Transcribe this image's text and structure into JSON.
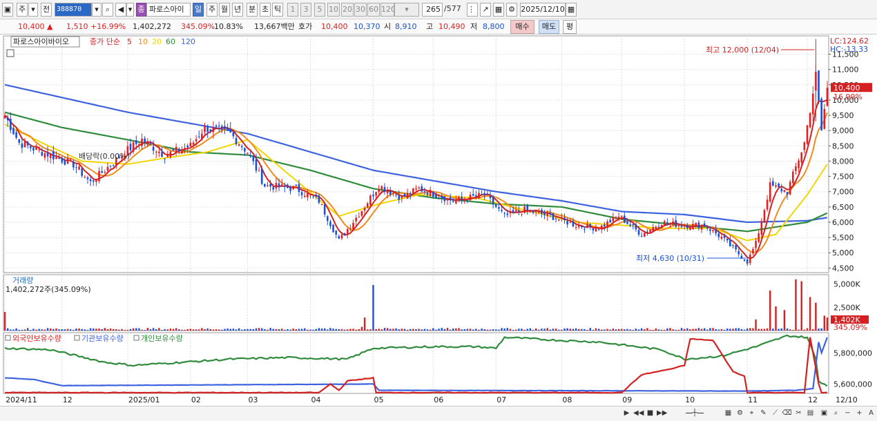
{
  "toolbar": {
    "market": "주",
    "prev": "전",
    "code": "388870",
    "badge": "종",
    "stock_name": "파로스아이",
    "periods": [
      "일",
      "주",
      "월",
      "년",
      "분",
      "초",
      "틱"
    ],
    "active_period": "일",
    "intervals": [
      "1",
      "3",
      "5",
      "10",
      "20",
      "30",
      "60",
      "120"
    ],
    "count_value": "265",
    "count_total": "/577",
    "date": "2025/12/10"
  },
  "price": {
    "current": "10,400",
    "change": "1,510",
    "change_pct": "+16.99%",
    "volume": "1,402,272",
    "volume_pct": "345.09%",
    "turnover": "10.83%",
    "amount": "13,667백만",
    "quote_label": "호가",
    "ask": "10,400",
    "bid": "10,370",
    "open_label": "시",
    "open": "8,910",
    "high_label": "고",
    "high": "10,490",
    "low_label": "저",
    "low": "8,800",
    "buy_label": "매수",
    "sell_label": "매도",
    "eval_label": "평"
  },
  "chart_data": [
    {
      "type": "candlestick",
      "title": "파로스아이바이오",
      "legend_prefix": "종가 단순",
      "ma_periods": [
        5,
        10,
        20,
        60,
        120
      ],
      "ma_colors": [
        "#d42020",
        "#f08a1c",
        "#f2d600",
        "#2e8b3a",
        "#3c62e0"
      ],
      "y_ticks": [
        4500,
        5000,
        5500,
        6000,
        6500,
        7000,
        7500,
        8000,
        8500,
        9000,
        9500,
        10000,
        10500,
        11000,
        11500
      ],
      "y_tick_labels": [
        "4,500",
        "5,000",
        "5,500",
        "6,000",
        "6,500",
        "7,000",
        "7,500",
        "8,000",
        "8,500",
        "9,000",
        "9,500",
        "10,000",
        "10,500",
        "11,000",
        "11,500"
      ],
      "ylim": [
        4350,
        12100
      ],
      "x_labels": [
        "2024/11",
        "12",
        "2025/01",
        "02",
        "03",
        "04",
        "05",
        "06",
        "07",
        "08",
        "09",
        "10",
        "11",
        "12",
        "12/10"
      ],
      "x_label_dates": [
        "2024-11-01",
        "2024-12-01",
        "2025-01-01",
        "2025-02-01",
        "2025-03-01",
        "2025-04-01",
        "2025-05-01",
        "2025-06-01",
        "2025-07-01",
        "2025-08-01",
        "2025-09-01",
        "2025-10-01",
        "2025-11-01",
        "2025-12-01",
        "2025-12-10"
      ],
      "close_keypoints": [
        [
          "2024-11-01",
          9500
        ],
        [
          "2024-11-10",
          8600
        ],
        [
          "2024-11-20",
          8300
        ],
        [
          "2024-12-05",
          7900
        ],
        [
          "2024-12-15",
          7300
        ],
        [
          "2024-12-31",
          8300
        ],
        [
          "2025-01-08",
          8700
        ],
        [
          "2025-01-20",
          8200
        ],
        [
          "2025-01-31",
          8500
        ],
        [
          "2025-02-08",
          9100
        ],
        [
          "2025-02-20",
          8900
        ],
        [
          "2025-03-01",
          8300
        ],
        [
          "2025-03-10",
          7200
        ],
        [
          "2025-03-25",
          7100
        ],
        [
          "2025-04-05",
          6700
        ],
        [
          "2025-04-15",
          5400
        ],
        [
          "2025-04-25",
          6400
        ],
        [
          "2025-05-05",
          7200
        ],
        [
          "2025-05-15",
          6800
        ],
        [
          "2025-05-25",
          7100
        ],
        [
          "2025-06-10",
          6700
        ],
        [
          "2025-06-25",
          6900
        ],
        [
          "2025-07-05",
          6200
        ],
        [
          "2025-07-15",
          6400
        ],
        [
          "2025-07-28",
          6200
        ],
        [
          "2025-08-10",
          5900
        ],
        [
          "2025-08-20",
          5800
        ],
        [
          "2025-08-31",
          6200
        ],
        [
          "2025-09-10",
          5600
        ],
        [
          "2025-09-20",
          6000
        ],
        [
          "2025-09-30",
          5900
        ],
        [
          "2025-10-10",
          5900
        ],
        [
          "2025-10-20",
          5500
        ],
        [
          "2025-10-31",
          4700
        ],
        [
          "2025-11-05",
          5300
        ],
        [
          "2025-11-12",
          7200
        ],
        [
          "2025-11-20",
          7000
        ],
        [
          "2025-11-28",
          8600
        ],
        [
          "2025-12-04",
          10800
        ],
        [
          "2025-12-08",
          9000
        ],
        [
          "2025-12-10",
          10400
        ]
      ],
      "ma_keypoints": {
        "120": [
          [
            "2024-11-01",
            10500
          ],
          [
            "2025-01-01",
            9600
          ],
          [
            "2025-03-01",
            8900
          ],
          [
            "2025-05-01",
            7700
          ],
          [
            "2025-07-01",
            7000
          ],
          [
            "2025-08-01",
            6700
          ],
          [
            "2025-09-01",
            6350
          ],
          [
            "2025-10-01",
            6250
          ],
          [
            "2025-11-01",
            6000
          ],
          [
            "2025-12-01",
            6050
          ],
          [
            "2025-12-10",
            6150
          ]
        ],
        "60": [
          [
            "2024-11-01",
            9600
          ],
          [
            "2024-12-01",
            9100
          ],
          [
            "2025-01-01",
            8700
          ],
          [
            "2025-02-01",
            8300
          ],
          [
            "2025-03-01",
            8200
          ],
          [
            "2025-04-01",
            7700
          ],
          [
            "2025-05-01",
            7100
          ],
          [
            "2025-06-01",
            6800
          ],
          [
            "2025-07-01",
            6600
          ],
          [
            "2025-08-01",
            6500
          ],
          [
            "2025-09-01",
            6100
          ],
          [
            "2025-10-01",
            5900
          ],
          [
            "2025-11-01",
            5700
          ],
          [
            "2025-12-01",
            6000
          ],
          [
            "2025-12-10",
            6300
          ]
        ],
        "20": [
          [
            "2024-11-01",
            9200
          ],
          [
            "2024-11-20",
            8600
          ],
          [
            "2024-12-10",
            8000
          ],
          [
            "2025-01-01",
            7900
          ],
          [
            "2025-01-20",
            8100
          ],
          [
            "2025-02-10",
            8300
          ],
          [
            "2025-03-01",
            8700
          ],
          [
            "2025-03-20",
            7600
          ],
          [
            "2025-04-15",
            6200
          ],
          [
            "2025-05-05",
            6600
          ],
          [
            "2025-05-25",
            6900
          ],
          [
            "2025-06-20",
            6800
          ],
          [
            "2025-07-15",
            6400
          ],
          [
            "2025-08-10",
            6000
          ],
          [
            "2025-09-01",
            5900
          ],
          [
            "2025-09-20",
            5800
          ],
          [
            "2025-10-15",
            5800
          ],
          [
            "2025-11-01",
            5400
          ],
          [
            "2025-11-15",
            5600
          ],
          [
            "2025-12-01",
            6900
          ],
          [
            "2025-12-10",
            7900
          ]
        ]
      },
      "annotations": [
        {
          "text": "최고 12,000 (12/04)",
          "date": "2025-12-04",
          "value": 12000
        },
        {
          "text": "최저 4,630 (10/31)",
          "date": "2025-10-31",
          "value": 4630
        },
        {
          "text": "배당락(0.00%)",
          "date": "2024-12-27",
          "value": 8000
        }
      ],
      "last_price_label": "10,400",
      "last_pct_label": "16.99%",
      "lc_label": "LC:124.62",
      "hc_label": "HC:-13.33"
    },
    {
      "type": "bar",
      "title": "거래량",
      "summary": "1,402,272주(345.09%)",
      "y_ticks": [
        2500000,
        5000000
      ],
      "y_tick_labels": [
        "2,500K",
        "5,000K"
      ],
      "ylim": [
        0,
        6000000
      ],
      "last_volume_label": "1,402K",
      "last_pct_label": "345.09%",
      "volume_spikes": [
        [
          "2024-11-01",
          2000000
        ],
        [
          "2025-04-25",
          400000
        ],
        [
          "2025-05-01",
          4900000
        ],
        [
          "2025-04-28",
          1400000
        ],
        [
          "2025-11-05",
          1200000
        ],
        [
          "2025-11-12",
          4300000
        ],
        [
          "2025-11-14",
          2600000
        ],
        [
          "2025-11-19",
          2200000
        ],
        [
          "2025-11-25",
          5500000
        ],
        [
          "2025-11-27",
          5300000
        ],
        [
          "2025-12-02",
          3600000
        ],
        [
          "2025-12-04",
          3000000
        ],
        [
          "2025-12-09",
          1600000
        ],
        [
          "2025-12-10",
          1400000
        ]
      ],
      "base_volume": 180000
    },
    {
      "type": "line",
      "series_names": [
        "외국인보유수량",
        "기관보유수량",
        "개인보유수량"
      ],
      "series_colors": [
        "#d42020",
        "#3c62e0",
        "#2e8b3a"
      ],
      "y_ticks": [
        5600000,
        5800000
      ],
      "y_tick_labels": [
        "5,600,000",
        "5,800,000"
      ],
      "ylim": [
        5540000,
        5930000
      ],
      "individual_keypoints": [
        [
          "2024-11-01",
          5830000
        ],
        [
          "2024-11-25",
          5820000
        ],
        [
          "2024-12-20",
          5740000
        ],
        [
          "2025-01-05",
          5720000
        ],
        [
          "2025-02-20",
          5760000
        ],
        [
          "2025-03-20",
          5770000
        ],
        [
          "2025-04-20",
          5760000
        ],
        [
          "2025-05-01",
          5830000
        ],
        [
          "2025-06-01",
          5840000
        ],
        [
          "2025-06-20",
          5840000
        ],
        [
          "2025-07-01",
          5830000
        ],
        [
          "2025-07-05",
          5900000
        ],
        [
          "2025-08-01",
          5880000
        ],
        [
          "2025-08-20",
          5870000
        ],
        [
          "2025-09-20",
          5820000
        ],
        [
          "2025-10-01",
          5760000
        ],
        [
          "2025-10-20",
          5780000
        ],
        [
          "2025-11-05",
          5840000
        ],
        [
          "2025-11-20",
          5910000
        ],
        [
          "2025-12-01",
          5900000
        ],
        [
          "2025-12-04",
          5760000
        ],
        [
          "2025-12-06",
          5620000
        ],
        [
          "2025-12-10",
          5590000
        ]
      ],
      "institution_keypoints": [
        [
          "2024-11-01",
          5640000
        ],
        [
          "2024-11-15",
          5630000
        ],
        [
          "2024-12-01",
          5590000
        ],
        [
          "2025-05-01",
          5600000
        ],
        [
          "2025-05-05",
          5560000
        ],
        [
          "2025-10-31",
          5555000
        ],
        [
          "2025-11-25",
          5560000
        ],
        [
          "2025-12-03",
          5570000
        ],
        [
          "2025-12-05",
          5870000
        ],
        [
          "2025-12-08",
          5800000
        ],
        [
          "2025-12-10",
          5900000
        ]
      ],
      "foreign_keypoints": [
        [
          "2024-11-01",
          5545000
        ],
        [
          "2025-04-05",
          5545000
        ],
        [
          "2025-04-10",
          5600000
        ],
        [
          "2025-04-15",
          5560000
        ],
        [
          "2025-04-20",
          5620000
        ],
        [
          "2025-05-01",
          5640000
        ],
        [
          "2025-05-03",
          5545000
        ],
        [
          "2025-09-01",
          5545000
        ],
        [
          "2025-09-10",
          5660000
        ],
        [
          "2025-09-25",
          5700000
        ],
        [
          "2025-10-01",
          5720000
        ],
        [
          "2025-10-05",
          5890000
        ],
        [
          "2025-10-15",
          5880000
        ],
        [
          "2025-10-25",
          5680000
        ],
        [
          "2025-10-30",
          5650000
        ],
        [
          "2025-11-01",
          5545000
        ],
        [
          "2025-11-28",
          5545000
        ],
        [
          "2025-12-02",
          5900000
        ],
        [
          "2025-12-05",
          5600000
        ],
        [
          "2025-12-07",
          5545000
        ],
        [
          "2025-12-10",
          5545000
        ]
      ]
    }
  ],
  "bottom": {
    "icons": [
      "play-icon",
      "rewind-icon",
      "stop-icon",
      "fast-forward-icon",
      "slider-icon",
      "settings-icon",
      "zoom-out-icon",
      "minus-icon",
      "plus-icon",
      "font-icon"
    ]
  }
}
